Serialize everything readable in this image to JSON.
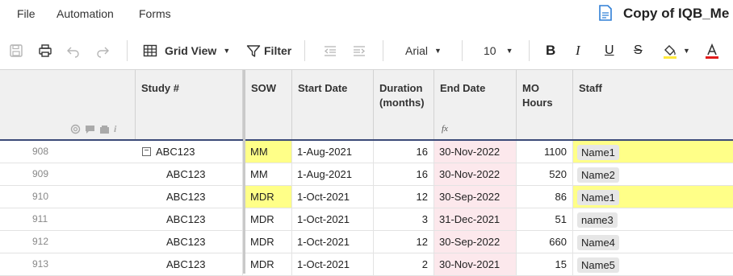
{
  "menubar": {
    "items": [
      "File",
      "Automation",
      "Forms"
    ],
    "doc_title": "Copy of IQB_Me"
  },
  "toolbar": {
    "view_label": "Grid View",
    "filter_label": "Filter",
    "font_name": "Arial",
    "font_size": "10",
    "highlight_color": "#ffe83b",
    "text_color": "#e11a1a"
  },
  "grid": {
    "columns": [
      "Study #",
      "SOW",
      "Start Date",
      "Duration (months)",
      "End Date",
      "MO Hours",
      "Staff"
    ],
    "columns_split": {
      "duration": [
        "Duration",
        "(months)"
      ],
      "mohours": [
        "MO",
        "Hours"
      ]
    },
    "formula_icon": "fx",
    "rows": [
      {
        "num": "908",
        "study": "ABC123",
        "sow": "MM",
        "start": "1-Aug-2021",
        "duration": "16",
        "end": "30-Nov-2022",
        "hours": "1100",
        "staff": "Name1",
        "sow_hl": true,
        "staff_hl": true,
        "parent": true
      },
      {
        "num": "909",
        "study": "ABC123",
        "sow": "MM",
        "start": "1-Aug-2021",
        "duration": "16",
        "end": "30-Nov-2022",
        "hours": "520",
        "staff": "Name2",
        "sow_hl": false,
        "staff_hl": false,
        "parent": false
      },
      {
        "num": "910",
        "study": "ABC123",
        "sow": "MDR",
        "start": "1-Oct-2021",
        "duration": "12",
        "end": "30-Sep-2022",
        "hours": "86",
        "staff": "Name1",
        "sow_hl": true,
        "staff_hl": true,
        "parent": false
      },
      {
        "num": "911",
        "study": "ABC123",
        "sow": "MDR",
        "start": "1-Oct-2021",
        "duration": "3",
        "end": "31-Dec-2021",
        "hours": "51",
        "staff": "name3",
        "sow_hl": false,
        "staff_hl": false,
        "parent": false
      },
      {
        "num": "912",
        "study": "ABC123",
        "sow": "MDR",
        "start": "1-Oct-2021",
        "duration": "12",
        "end": "30-Sep-2022",
        "hours": "660",
        "staff": "Name4",
        "sow_hl": false,
        "staff_hl": false,
        "parent": false
      },
      {
        "num": "913",
        "study": "ABC123",
        "sow": "MDR",
        "start": "1-Oct-2021",
        "duration": "2",
        "end": "30-Nov-2021",
        "hours": "15",
        "staff": "Name5",
        "sow_hl": false,
        "staff_hl": false,
        "parent": false
      }
    ]
  },
  "colors": {
    "highlight": "#ffff88",
    "end_date_bg": "#fce8ec",
    "header_bg": "#f0f0f0",
    "accent_line": "#3b4a78"
  }
}
